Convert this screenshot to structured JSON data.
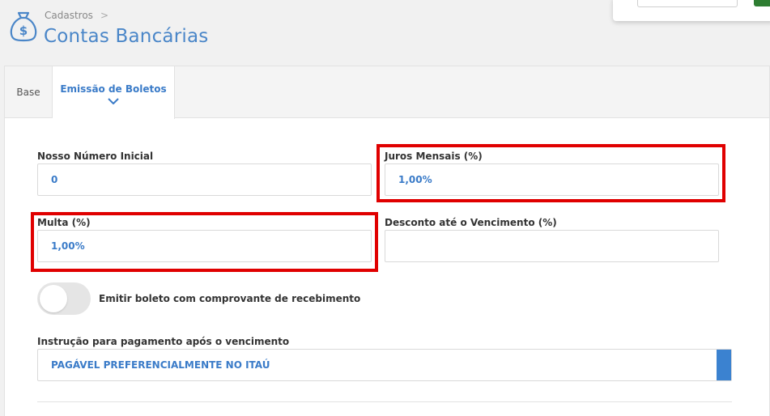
{
  "header": {
    "breadcrumb": "Cadastros",
    "breadcrumb_separator": ">",
    "title": "Contas Bancárias",
    "icon": "money-bag-icon"
  },
  "tabs": [
    {
      "label": "Base",
      "active": false
    },
    {
      "label": "Emissão de Boletos",
      "active": true
    }
  ],
  "form": {
    "nosso_numero": {
      "label": "Nosso Número Inicial",
      "value": "0"
    },
    "juros": {
      "label": "Juros Mensais (%)",
      "value": "1,00%",
      "highlighted": true
    },
    "multa": {
      "label": "Multa (%)",
      "value": "1,00%",
      "highlighted": true
    },
    "desconto": {
      "label": "Desconto até o Vencimento (%)",
      "value": ""
    },
    "comprovante_toggle": {
      "label": "Emitir boleto com comprovante de recebimento",
      "on": false
    },
    "instrucao": {
      "label": "Instrução para pagamento após o vencimento",
      "value": "PAGÁVEL PREFERENCIALMENTE NO ITAÚ"
    }
  },
  "colors": {
    "accent": "#4a86c8",
    "highlight": "#e00000",
    "value_text": "#3a7bc8"
  }
}
